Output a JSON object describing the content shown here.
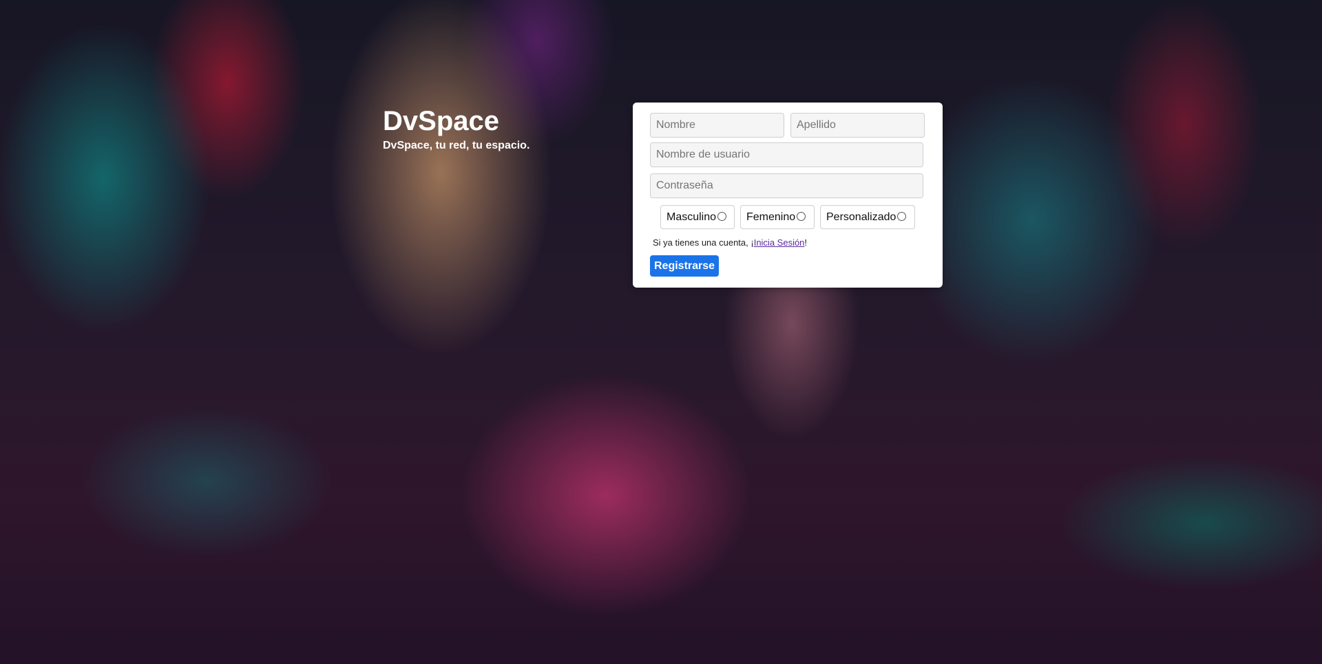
{
  "brand": {
    "title": "DvSpace",
    "tagline": "DvSpace, tu red, tu espacio."
  },
  "form": {
    "first_name_placeholder": "Nombre",
    "last_name_placeholder": "Apellido",
    "username_placeholder": "Nombre de usuario",
    "password_placeholder": "Contraseña",
    "gender_options": [
      "Masculino",
      "Femenino",
      "Personalizado"
    ],
    "login_prefix": "Si ya tienes una cuenta, ¡",
    "login_link": "Inicia Sesión",
    "login_suffix": "!",
    "register_label": "Registrarse"
  },
  "colors": {
    "button": "#1a73e8",
    "link": "#5a2aa0",
    "card": "#ffffff"
  }
}
